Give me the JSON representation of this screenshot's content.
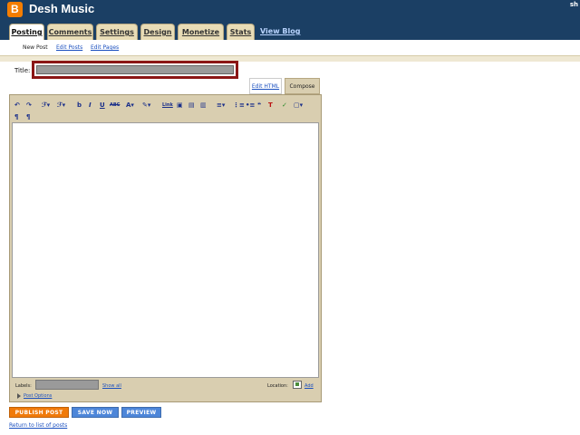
{
  "header": {
    "blog_title": "Desh Music",
    "corner_text": "sh",
    "tabs": [
      "Posting",
      "Comments",
      "Settings",
      "Design",
      "Monetize",
      "Stats"
    ],
    "view_blog": "View Blog"
  },
  "subnav": {
    "items": [
      "New Post",
      "Edit Posts",
      "Edit Pages"
    ]
  },
  "post": {
    "title_label": "Title:",
    "title_value": ""
  },
  "editor": {
    "mode_html": "Edit HTML",
    "mode_compose": "Compose",
    "toolbar": {
      "undo": "↶",
      "redo": "↷",
      "font": "ℱ▾",
      "font_size": "ℱ▾",
      "bold": "b",
      "italic": "I",
      "underline": "U",
      "strike": "ABC",
      "text_color": "A▾",
      "highlight": "✎▾",
      "link": "Link",
      "image": "▣",
      "video": "▤",
      "jump_break": "▥",
      "align": "≡▾",
      "numbered_list": "⋮≡",
      "bulleted_list": "•≡",
      "quote": "❝",
      "clear_format": "T",
      "spell_check": "✓",
      "more": "▢▾",
      "ltr": "¶",
      "rtl": "¶"
    },
    "labels_label": "Labels:",
    "show_all": "Show all",
    "location_label": "Location:",
    "add": "Add",
    "post_options": "Post Options"
  },
  "actions": {
    "publish": "PUBLISH POST",
    "save": "SAVE NOW",
    "preview": "PREVIEW",
    "return": "Return to list of posts"
  },
  "colors": {
    "header_bg": "#1b3f64",
    "logo": "#f57d00",
    "tab_bg": "#e8dcb6",
    "frame_bg": "#d9ceb0",
    "title_border": "#8b1515",
    "publish": "#f07a0a",
    "save": "#4d86d9",
    "link": "#1a4fbf"
  }
}
